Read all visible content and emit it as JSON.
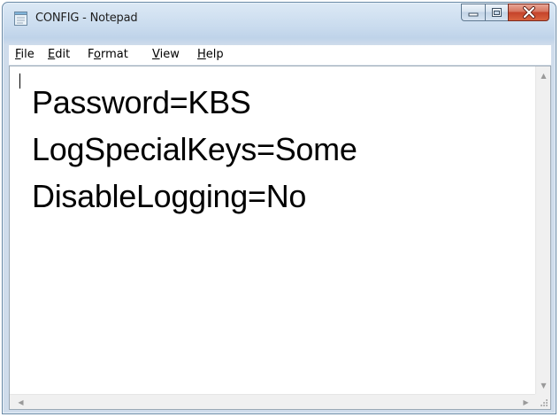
{
  "window": {
    "title": "CONFIG - Notepad"
  },
  "icons": {
    "app": "notepad-icon",
    "minimize": "minimize-icon",
    "maximize": "maximize-icon",
    "close": "close-icon",
    "scroll_up": "scroll-up-arrow-icon",
    "scroll_down": "scroll-down-arrow-icon",
    "scroll_left": "scroll-left-arrow-icon",
    "scroll_right": "scroll-right-arrow-icon",
    "resize_grip": "resize-grip-icon"
  },
  "menu": {
    "file": {
      "accel": "F",
      "rest": "ile"
    },
    "edit": {
      "accel": "E",
      "rest": "dit"
    },
    "format": {
      "pre": "F",
      "accel": "o",
      "rest": "rmat"
    },
    "view": {
      "accel": "V",
      "rest": "iew"
    },
    "help": {
      "accel": "H",
      "rest": "elp"
    }
  },
  "document": {
    "lines": [
      "Password=KBS",
      "LogSpecialKeys=Some",
      "DisableLogging=No"
    ]
  },
  "colors": {
    "close_button": "#c5422a",
    "frame": "#c9dbee"
  }
}
